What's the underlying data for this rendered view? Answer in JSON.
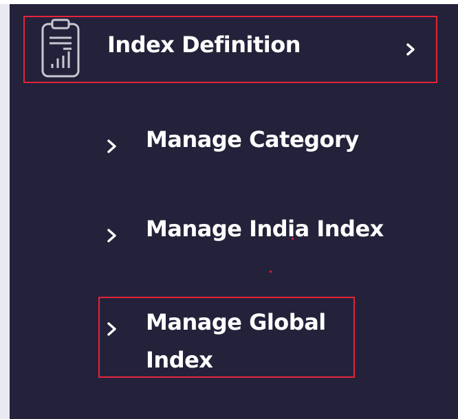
{
  "sidebar": {
    "parent": {
      "label": "Index Definition",
      "icon": "report-chart-icon",
      "chevron_icon": "chevron-right-icon"
    },
    "children": [
      {
        "label": "Manage Category",
        "icon": "chevron-right-icon"
      },
      {
        "label": "Manage India Index",
        "icon": "chevron-right-icon"
      },
      {
        "label": "Manage Global Index",
        "icon": "chevron-right-icon"
      }
    ]
  },
  "colors": {
    "sidebar_bg": "#23223a",
    "text": "#ffffff",
    "highlight": "#e5243b"
  }
}
